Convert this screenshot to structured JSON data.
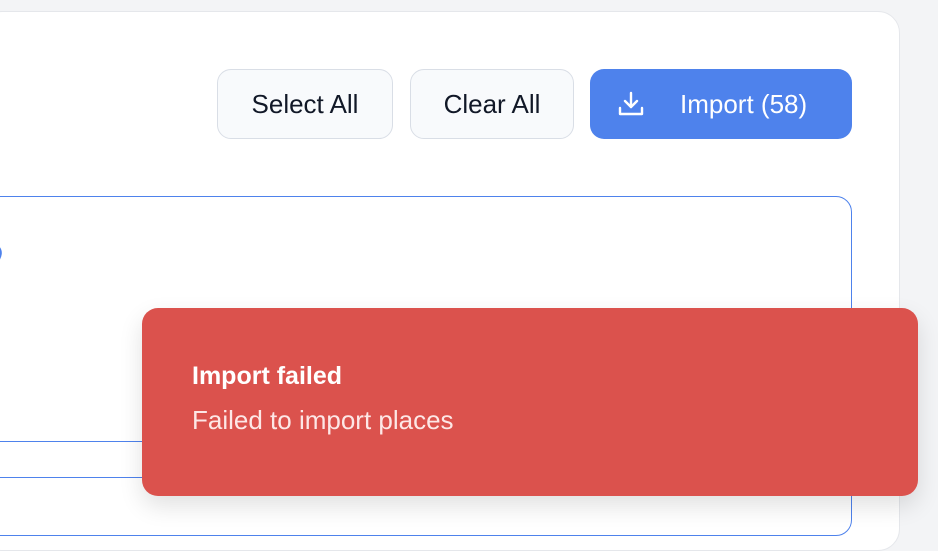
{
  "toolbar": {
    "select_all_label": "Select All",
    "clear_all_label": "Clear All",
    "import_label": "Import (58)",
    "import_icon": "download-icon"
  },
  "toast": {
    "title": "Import failed",
    "message": "Failed to import places"
  },
  "colors": {
    "accent": "#4e82ec",
    "error": "#db524d"
  }
}
